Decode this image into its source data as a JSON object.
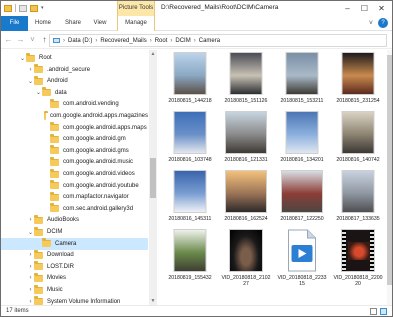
{
  "window": {
    "title": "D:\\Recovered_Mails\\Root\\DCIM\\Camera",
    "tools_tab": "Picture Tools",
    "controls": [
      "–",
      "☐",
      "✕"
    ]
  },
  "ribbon": {
    "tabs": [
      "File",
      "Home",
      "Share",
      "View",
      "Manage"
    ],
    "expand_icon": "˅",
    "help": "?"
  },
  "address": {
    "back": "←",
    "forward": "→",
    "recent": "˅",
    "up": "↑",
    "crumbs": [
      "Data (D:)",
      "Recovered_Mails",
      "Root",
      "DCIM",
      "Camera"
    ],
    "separator": "›"
  },
  "tree": [
    {
      "label": "Root",
      "indent": 0,
      "expanded": true
    },
    {
      "label": ".android_secure",
      "indent": 1,
      "expanded": false
    },
    {
      "label": "Android",
      "indent": 1,
      "expanded": true
    },
    {
      "label": "data",
      "indent": 2,
      "expanded": true
    },
    {
      "label": "com.android.vending",
      "indent": 3,
      "expanded": false
    },
    {
      "label": "com.google.android.apps.magazines",
      "indent": 3,
      "expanded": false
    },
    {
      "label": "com.google.android.apps.maps",
      "indent": 3,
      "expanded": false
    },
    {
      "label": "com.google.android.gm",
      "indent": 3,
      "expanded": false
    },
    {
      "label": "com.google.android.gms",
      "indent": 3,
      "expanded": false
    },
    {
      "label": "com.google.android.music",
      "indent": 3,
      "expanded": false
    },
    {
      "label": "com.google.android.videos",
      "indent": 3,
      "expanded": false
    },
    {
      "label": "com.google.android.youtube",
      "indent": 3,
      "expanded": false
    },
    {
      "label": "com.mapfactor.navigator",
      "indent": 3,
      "expanded": false
    },
    {
      "label": "com.sec.android.gallery3d",
      "indent": 3,
      "expanded": false
    },
    {
      "label": "AudioBooks",
      "indent": 1,
      "expanded": false
    },
    {
      "label": "DCIM",
      "indent": 1,
      "expanded": true
    },
    {
      "label": "Camera",
      "indent": 2,
      "expanded": false,
      "selected": true
    },
    {
      "label": "Download",
      "indent": 1,
      "expanded": false
    },
    {
      "label": "LOST.DIR",
      "indent": 1,
      "expanded": false
    },
    {
      "label": "Movies",
      "indent": 1,
      "expanded": false
    },
    {
      "label": "Music",
      "indent": 1,
      "expanded": false
    },
    {
      "label": "System Volume Information",
      "indent": 1,
      "expanded": false
    }
  ],
  "files": [
    {
      "name": "20180815_144218",
      "kind": "portrait",
      "colors": [
        "#bcd3ea",
        "#8aa7c3",
        "#5c5147"
      ]
    },
    {
      "name": "20180815_151126",
      "kind": "portrait",
      "colors": [
        "#4a4c55",
        "#c8c2b4",
        "#2c2e33"
      ]
    },
    {
      "name": "20180815_153211",
      "kind": "portrait",
      "colors": [
        "#7b8fa6",
        "#a9b9c7",
        "#3d3a35"
      ]
    },
    {
      "name": "20180815_231254",
      "kind": "portrait",
      "colors": [
        "#1e1a1c",
        "#c98a4f",
        "#5b2a1e"
      ]
    },
    {
      "name": "20180816_103748",
      "kind": "portrait",
      "colors": [
        "#3d6fb8",
        "#6b90c8",
        "#e3e7ee"
      ]
    },
    {
      "name": "20180816_121331",
      "kind": "landscape",
      "colors": [
        "#c7d4e0",
        "#8a8a8a",
        "#3e3a35"
      ]
    },
    {
      "name": "20180816_134201",
      "kind": "portrait",
      "colors": [
        "#4d76b5",
        "#8cb0dd",
        "#dfe6f1"
      ]
    },
    {
      "name": "20180816_140742",
      "kind": "portrait",
      "colors": [
        "#d9d2c4",
        "#8c8371",
        "#3b3833"
      ]
    },
    {
      "name": "20180816_145311",
      "kind": "portrait",
      "colors": [
        "#3a65ad",
        "#7a9ed2",
        "#eef1f6"
      ]
    },
    {
      "name": "20180816_162524",
      "kind": "landscape",
      "colors": [
        "#f4c07a",
        "#9b7458",
        "#2e2a29"
      ]
    },
    {
      "name": "20180817_122250",
      "kind": "landscape",
      "colors": [
        "#d8dde3",
        "#8c3d36",
        "#4c4742"
      ]
    },
    {
      "name": "20180817_133635",
      "kind": "portrait",
      "colors": [
        "#c7d2df",
        "#8f96a0",
        "#4e4f52"
      ]
    },
    {
      "name": "20180819_155432",
      "kind": "portrait",
      "colors": [
        "#eef2ea",
        "#6b8a4c",
        "#3d3f32"
      ]
    },
    {
      "name": "VID_20180818_210227",
      "kind": "video-dark",
      "colors": [
        "#1a1a1a",
        "#7a5d4a",
        "#000000"
      ]
    },
    {
      "name": "VID_20180818_223315",
      "kind": "video-icon",
      "colors": [
        "#ffffff",
        "#2d7fd4",
        "#c8d8ea"
      ]
    },
    {
      "name": "VID_20180818_220020",
      "kind": "video-film",
      "colors": [
        "#1a1514",
        "#d84a2c",
        "#000000"
      ]
    }
  ],
  "status": {
    "count": "17 items"
  },
  "accent": "#1979ca"
}
